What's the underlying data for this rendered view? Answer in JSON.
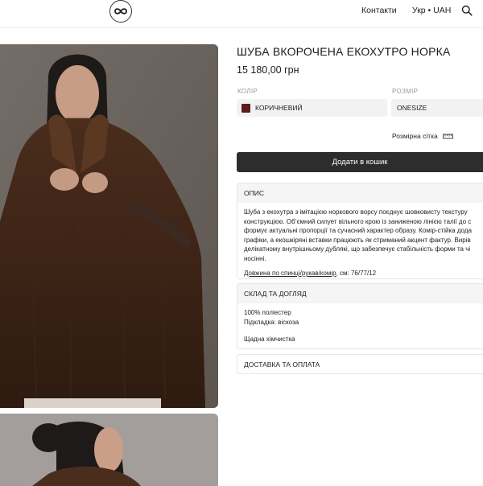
{
  "header": {
    "contacts": "Контакти",
    "lang_currency": "Укр • UAH"
  },
  "product": {
    "title": "ШУБА ВКОРОЧЕНА ЕКОХУТРО НОРКА",
    "price": "15 180,00 грн",
    "color_label": "КОЛІР",
    "color_value": "КОРИЧНЕВИЙ",
    "swatch_color": "#5a1c1f",
    "size_label": "РОЗМІР",
    "size_value": "ONESIZE",
    "size_chart": "Розмірна сітка",
    "add_to_cart": "Додати в кошик"
  },
  "accordion": {
    "description_title": "ОПИС",
    "description_lines": [
      "Шуба з екохутра з імітацією норкового ворсу поєднує шовковисту текстуру",
      "конструкцією. Об’ємний силует вільного крою із заниженою лінією талії до с",
      "формує актуальні пропорції та сучасний характер образу. Комір-стійка дода",
      "графіки, а екошкіряні вставки працюють як стриманий акцент фактур. Вирів",
      "делікатному внутрішньому дублякі, що забезпечує стабільність форми та чі",
      "носінні."
    ],
    "length_link": "Довжина по спинці/рукав/комір",
    "length_value": ", см: 76/77/12",
    "care_title": "СКЛАД ТА ДОГЛЯД",
    "care_line1": "100% поліестер",
    "care_line2": "Підкладка: віскоза",
    "care_line3": "Щадна хімчистка",
    "shipping_title": "ДОСТАВКА ТА ОПЛАТА"
  }
}
